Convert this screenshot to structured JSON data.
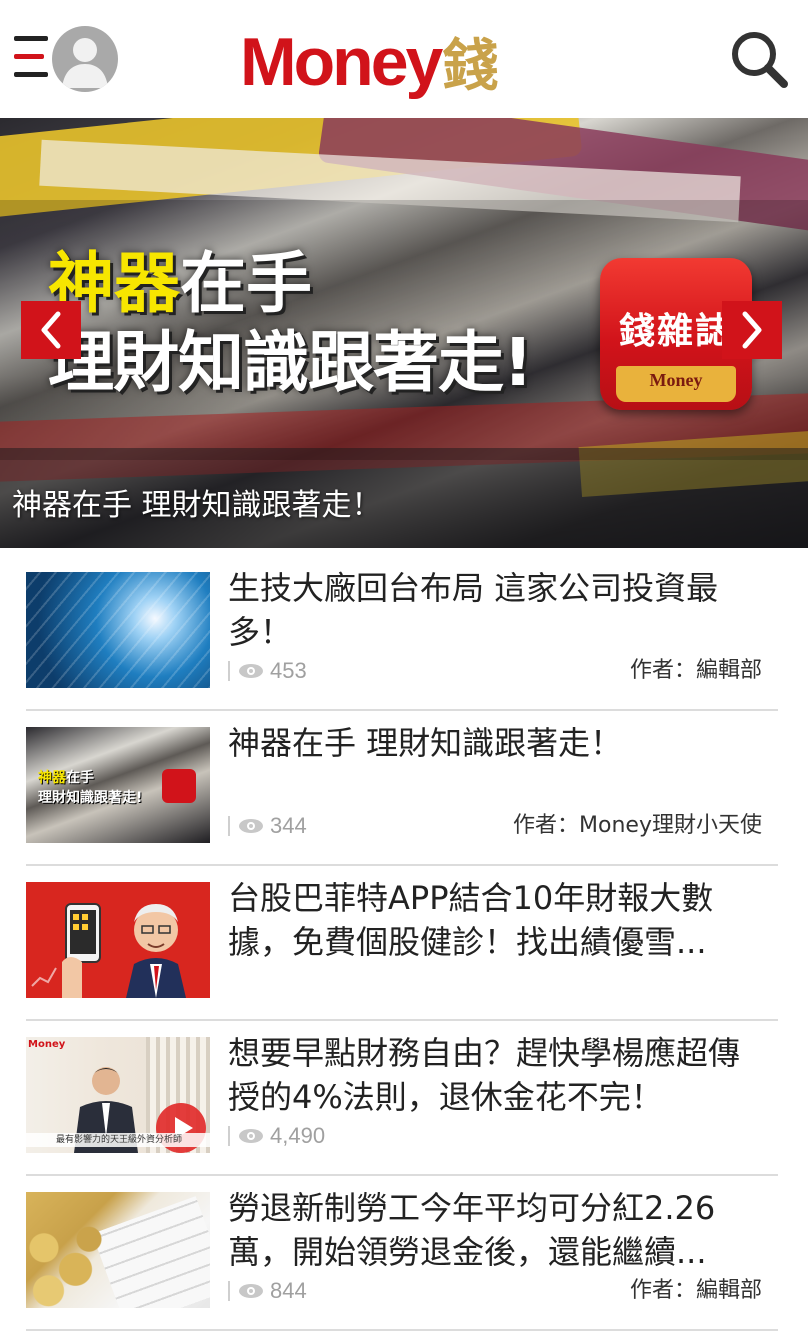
{
  "header": {
    "menu_icon": "hamburger-icon",
    "avatar_icon": "user-avatar-icon",
    "logo_latin": "Money",
    "logo_cjk": "錢",
    "search_icon": "search-icon",
    "colors": {
      "brand_red": "#d1131a",
      "brand_gold": "#c9a24a"
    }
  },
  "banner": {
    "headline_highlight": "神器",
    "headline_rest": "在手",
    "headline_line2": "理財知識跟著走!",
    "app_icon_title": "錢雜誌",
    "app_icon_label": "Money",
    "caption": "神器在手 理財知識跟著走！",
    "prev_icon": "chevron-left-icon",
    "next_icon": "chevron-right-icon"
  },
  "articles": [
    {
      "title": "生技大廠回台布局 這家公司投資最多！",
      "views": "453",
      "author": "作者：編輯部"
    },
    {
      "title": "神器在手 理財知識跟著走！",
      "views": "344",
      "author": "作者：Money理財小天使",
      "thumb_line1_highlight": "神器",
      "thumb_line1_rest": "在手",
      "thumb_line2": "理財知識跟著走!"
    },
    {
      "title": "台股巴菲特APP結合10年財報大數據，免費個股健診！找出績優雪...",
      "views": "",
      "author": ""
    },
    {
      "title": "想要早點財務自由？趕快學楊應超傳授的4%法則，退休金花不完！",
      "views": "4,490",
      "author": "",
      "thumb_brand": "Money",
      "thumb_caption": "最有影響力的天王級外資分析師"
    },
    {
      "title": "勞退新制勞工今年平均可分紅2.26萬，開始領勞退金後，還能繼續...",
      "views": "844",
      "author": "作者：編輯部"
    }
  ]
}
